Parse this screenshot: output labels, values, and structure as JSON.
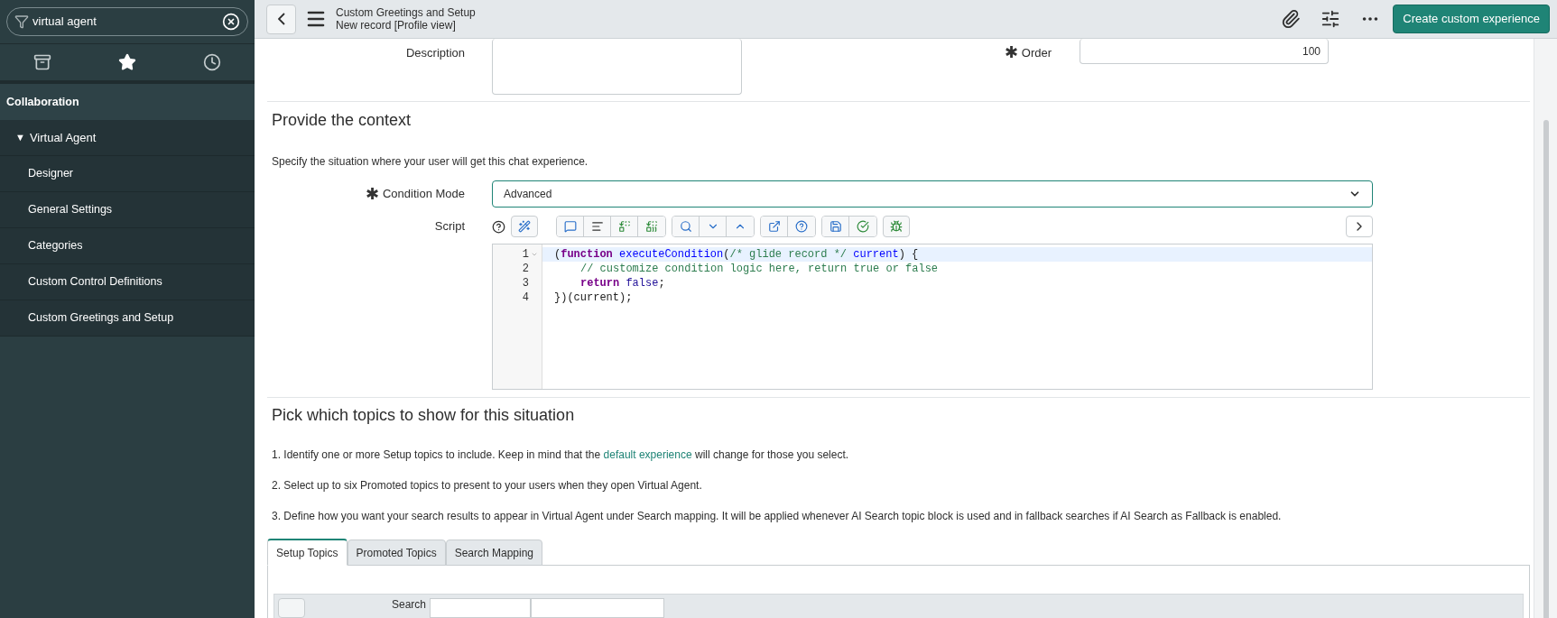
{
  "sidebar": {
    "filter": {
      "value": "virtual agent"
    },
    "section": "Collaboration",
    "group": {
      "label": "Virtual Agent",
      "marker": "▼",
      "expanded": true,
      "children": [
        {
          "label": "Designer"
        },
        {
          "label": "General Settings"
        },
        {
          "label": "Categories"
        },
        {
          "label": "Custom Control Definitions"
        },
        {
          "label": "Custom Greetings and Setup"
        }
      ]
    }
  },
  "header": {
    "title": "Custom Greetings and Setup",
    "subtitle": "New record [Profile view]",
    "primary_button": "Create custom experience"
  },
  "form": {
    "description": {
      "label": "Description"
    },
    "order": {
      "label": "Order",
      "required_mark": "✱",
      "value": "100"
    },
    "context_heading": "Provide the context",
    "context_text": "Specify the situation where your user will get this chat experience.",
    "condition_mode": {
      "label": "Condition Mode",
      "required_mark": "✱",
      "value": "Advanced"
    },
    "script": {
      "label": "Script",
      "lines": [
        {
          "number": "1",
          "active": true,
          "foldable": true,
          "indented": false,
          "tokens": [
            {
              "kind": "plain",
              "text": "("
            },
            {
              "kind": "keyword",
              "text": "function"
            },
            {
              "kind": "def",
              "text": " executeCondition"
            },
            {
              "kind": "plain",
              "text": "("
            },
            {
              "kind": "comment",
              "text": "/* glide record */"
            },
            {
              "kind": "def",
              "text": " current"
            },
            {
              "kind": "plain",
              "text": ") {"
            }
          ]
        },
        {
          "number": "2",
          "active": false,
          "foldable": false,
          "indented": true,
          "tokens": [
            {
              "kind": "comment",
              "text": "// customize condition logic here, return true or false"
            }
          ]
        },
        {
          "number": "3",
          "active": false,
          "foldable": false,
          "indented": true,
          "tokens": [
            {
              "kind": "keyword",
              "text": "return"
            },
            {
              "kind": "atom",
              "text": " false"
            },
            {
              "kind": "plain",
              "text": ";"
            }
          ]
        },
        {
          "number": "4",
          "active": false,
          "foldable": false,
          "indented": false,
          "tokens": [
            {
              "kind": "plain",
              "text": "})(current);"
            }
          ]
        }
      ]
    },
    "topics_heading": "Pick which topics to show for this situation",
    "steps": [
      {
        "before": "1. Identify one or more Setup topics to include. Keep in mind that the ",
        "link": "default experience",
        "after": " will change for those you select."
      },
      {
        "before": "2. Select up to six Promoted topics to present to your users when they open Virtual Agent."
      },
      {
        "before": "3. Define how you want your search results to appear in Virtual Agent under Search mapping. It will be applied whenever AI Search topic block is used and in fallback searches if AI Search as Fallback is enabled."
      }
    ],
    "tabs": [
      {
        "label": "Setup Topics",
        "selected": true
      },
      {
        "label": "Promoted Topics",
        "selected": false
      },
      {
        "label": "Search Mapping",
        "selected": false
      }
    ],
    "search_label": "Search"
  }
}
